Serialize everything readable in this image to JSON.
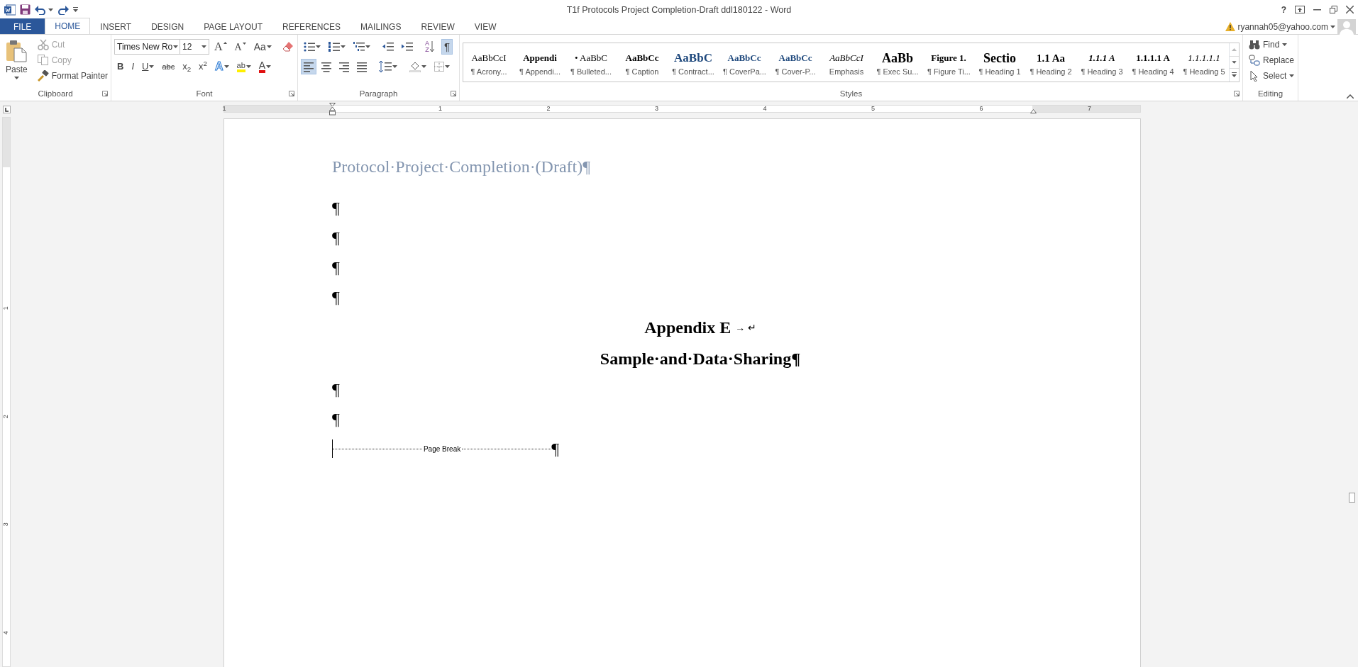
{
  "window": {
    "title": "T1f  Protocols Project Completion-Draft ddl180122 - Word",
    "help": "?"
  },
  "account": {
    "email": "ryannah05@yahoo.com",
    "warning": true
  },
  "tabs": [
    {
      "label": "FILE",
      "kind": "backstage",
      "selected": false
    },
    {
      "label": "HOME",
      "kind": "tab",
      "selected": true
    },
    {
      "label": "INSERT",
      "kind": "tab",
      "selected": false
    },
    {
      "label": "DESIGN",
      "kind": "tab",
      "selected": false
    },
    {
      "label": "PAGE LAYOUT",
      "kind": "tab",
      "selected": false
    },
    {
      "label": "REFERENCES",
      "kind": "tab",
      "selected": false
    },
    {
      "label": "MAILINGS",
      "kind": "tab",
      "selected": false
    },
    {
      "label": "REVIEW",
      "kind": "tab",
      "selected": false
    },
    {
      "label": "VIEW",
      "kind": "tab",
      "selected": false
    }
  ],
  "clipboard": {
    "label": "Clipboard",
    "paste": "Paste",
    "actions": [
      {
        "label": "Cut",
        "kind": "cut",
        "disabled": true
      },
      {
        "label": "Copy",
        "kind": "copy",
        "disabled": true
      },
      {
        "label": "Format Painter",
        "kind": "painter",
        "disabled": false
      }
    ]
  },
  "font": {
    "label": "Font",
    "font_name": "Times New Ro",
    "font_size": "12",
    "grow": "A",
    "shrink": "A",
    "change_case": "Aa",
    "formats": [
      {
        "glyph": "B",
        "kind": "bold"
      },
      {
        "glyph": "I",
        "kind": "italic"
      },
      {
        "glyph": "U",
        "kind": "underline"
      },
      {
        "glyph": "abc",
        "kind": "strike"
      },
      {
        "glyph": "x$_{2}$",
        "kind": "plain"
      },
      {
        "glyph": "x$^{2}$",
        "kind": "plain"
      }
    ],
    "effects": "A",
    "highlight": "ab",
    "font_color": "A"
  },
  "paragraph": {
    "label": "Paragraph",
    "sort": {
      "top": "A",
      "bottom": "Z"
    },
    "show_marks": {
      "glyph": "¶",
      "on": true
    },
    "alignments": [
      {
        "kind": "left",
        "selected": true
      },
      {
        "kind": "center",
        "selected": false
      },
      {
        "kind": "right",
        "selected": false
      },
      {
        "kind": "justify",
        "selected": false
      }
    ]
  },
  "styles": {
    "label": "Styles",
    "items": [
      {
        "preview": "AaBbCcI",
        "name": "¶ Acrony...",
        "kind": "normal"
      },
      {
        "preview": "Appendi",
        "name": "¶ Appendi...",
        "kind": "bold"
      },
      {
        "preview": "• AaBbC",
        "name": "¶ Bulleted...",
        "kind": "normal"
      },
      {
        "preview": "AaBbCc",
        "name": "¶ Caption",
        "kind": "bold"
      },
      {
        "preview": "AaBbC",
        "name": "¶ Contract...",
        "kind": "blue-large"
      },
      {
        "preview": "AaBbCc",
        "name": "¶ CoverPa...",
        "kind": "blue"
      },
      {
        "preview": "AaBbCc",
        "name": "¶ Cover-P...",
        "kind": "blue"
      },
      {
        "preview": "AaBbCcI",
        "name": "Emphasis",
        "kind": "italic"
      },
      {
        "preview": "AaBb",
        "name": "¶ Exec Su...",
        "kind": "large"
      },
      {
        "preview": "Figure 1.",
        "name": "¶ Figure Ti...",
        "kind": "bold"
      },
      {
        "preview": "Sectio",
        "name": "¶ Heading 1",
        "kind": "large"
      },
      {
        "preview": "1.1  Aa",
        "name": "¶ Heading 2",
        "kind": "bold-mid"
      },
      {
        "preview": "1.1.1  A",
        "name": "¶ Heading 3",
        "kind": "bold-italic"
      },
      {
        "preview": "1.1.1.1  A",
        "name": "¶ Heading 4",
        "kind": "bold"
      },
      {
        "preview": "1.1.1.1.1",
        "name": "¶ Heading 5",
        "kind": "italic"
      }
    ]
  },
  "editing": {
    "label": "Editing",
    "actions": [
      {
        "label": "Find",
        "kind": "find",
        "caret": true
      },
      {
        "label": "Replace",
        "kind": "replace",
        "caret": false
      },
      {
        "label": "Select",
        "kind": "select",
        "caret": true
      }
    ]
  },
  "ruler": {
    "marks": [
      "1",
      "1",
      "2",
      "3",
      "4",
      "5",
      "6",
      "7"
    ]
  },
  "vertical_ruler": {
    "marks": [
      "1",
      "2",
      "3",
      "4"
    ]
  },
  "document": {
    "paragraphs": [
      {
        "kind": "title",
        "text": "Protocol·Project·Completion·(Draft)¶"
      },
      {
        "kind": "mark",
        "text": "¶"
      },
      {
        "kind": "mark",
        "text": "¶"
      },
      {
        "kind": "mark",
        "text": "¶"
      },
      {
        "kind": "mark",
        "text": "¶"
      },
      {
        "kind": "heading",
        "text": "Appendix E",
        "end_mark": "→ ↵"
      },
      {
        "kind": "heading",
        "text": "Sample·and·Data·Sharing¶"
      },
      {
        "kind": "mark",
        "text": "¶"
      },
      {
        "kind": "mark",
        "text": "¶"
      },
      {
        "kind": "page_break",
        "text": "Page Break",
        "end_mark": "¶"
      }
    ]
  }
}
